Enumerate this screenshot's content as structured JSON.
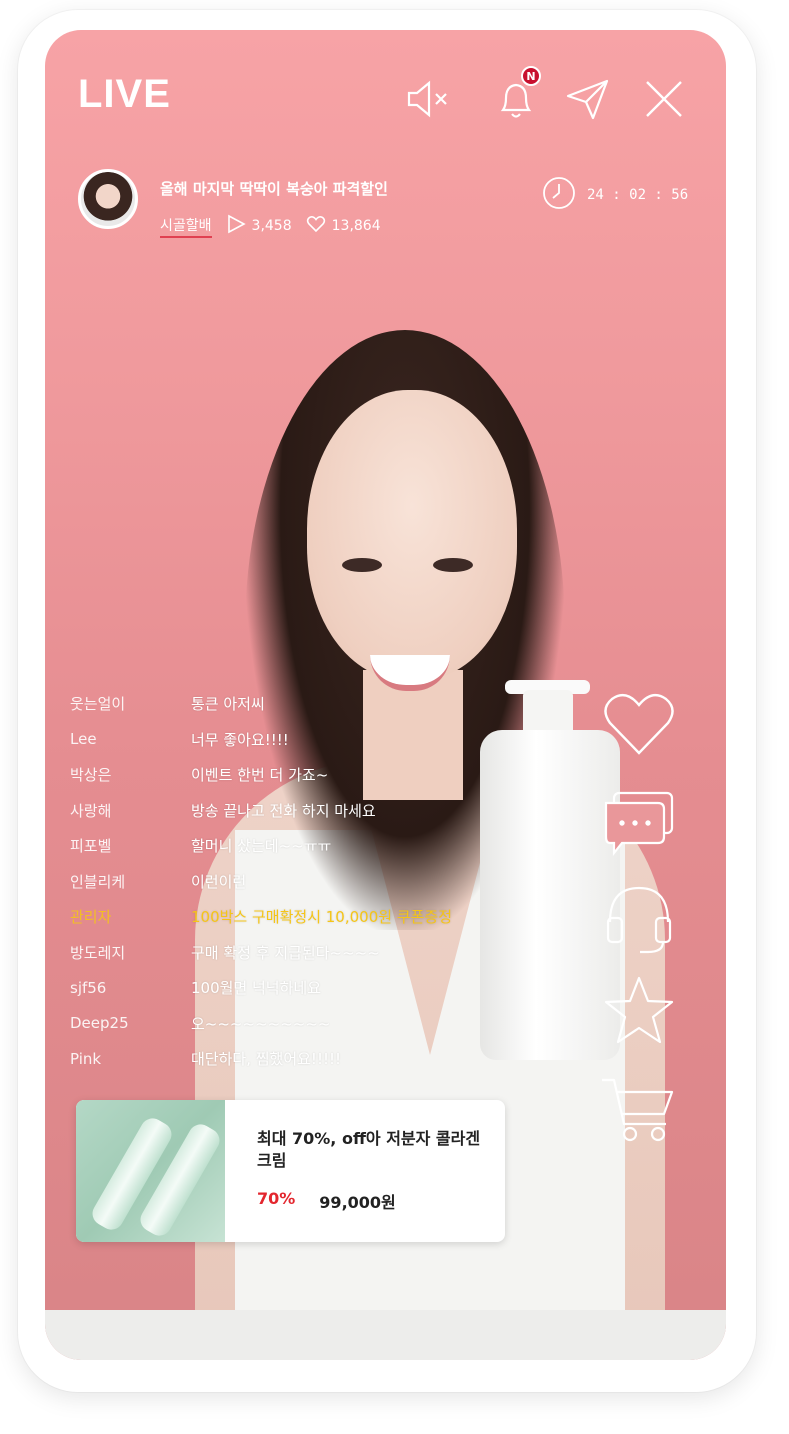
{
  "header": {
    "live_label": "LIVE",
    "bell_badge": "N"
  },
  "stream": {
    "title": "올해 마지막 딱딱이 복숭아 파격할인",
    "host": "시골할배",
    "views": "3,458",
    "likes": "13,864",
    "timer": "24 : 02 : 56"
  },
  "chat": [
    {
      "user": "웃는얼이",
      "msg": "통큰 아저씨",
      "highlight": false
    },
    {
      "user": "Lee",
      "msg": "너무 좋아요!!!!",
      "highlight": false
    },
    {
      "user": "박상은",
      "msg": "이벤트 한번 더 가죠~",
      "highlight": false
    },
    {
      "user": "사랑해",
      "msg": "방송 끝나고 전화 하지 마세요",
      "highlight": false
    },
    {
      "user": "피포벨",
      "msg": "할머니 샀는데~~ㅠㅠ",
      "highlight": false
    },
    {
      "user": "인블리케",
      "msg": "이런이런",
      "highlight": false
    },
    {
      "user": "관리자",
      "msg": "100박스 구매확정시 10,000원 쿠폰증정",
      "highlight": true
    },
    {
      "user": "방도레지",
      "msg": "구매 확정 후 지급된다~~~~",
      "highlight": false
    },
    {
      "user": "sjf56",
      "msg": "100월면 넉넉하네요",
      "highlight": false
    },
    {
      "user": "Deep25",
      "msg": "오~~~~~~~~~~",
      "highlight": false
    },
    {
      "user": "Pink",
      "msg": "대단하다, 찜했어요!!!!!",
      "highlight": false
    }
  ],
  "product": {
    "title": "최대 70%, off아 저분자 콜라겐 크림",
    "discount": "70%",
    "price": "99,000원"
  },
  "colors": {
    "background": "#f09a9d",
    "highlight": "#f5c518",
    "discount": "#e3262e",
    "badge": "#c8102e"
  },
  "icons": [
    "mute-icon",
    "bell-icon",
    "share-icon",
    "close-icon",
    "play-icon",
    "heart-icon",
    "clock-icon",
    "chat-icon",
    "headset-icon",
    "star-icon",
    "cart-icon"
  ]
}
